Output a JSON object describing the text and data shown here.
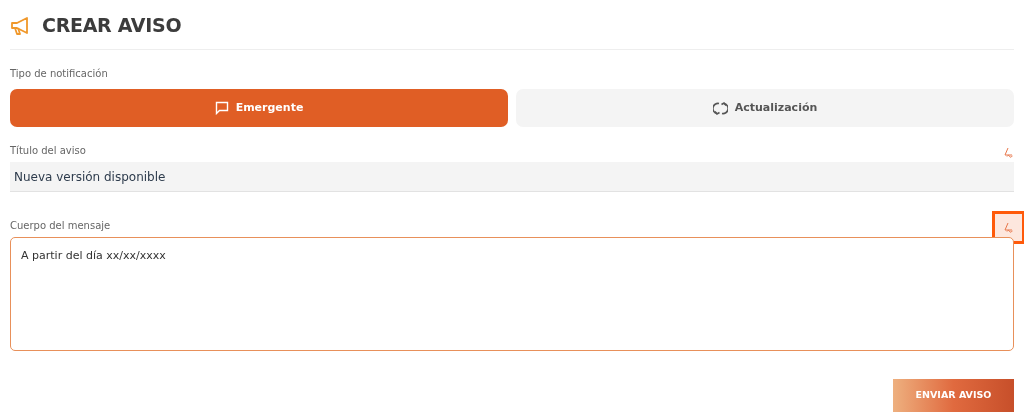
{
  "header": {
    "title": "CREAR AVISO"
  },
  "notification_type": {
    "label": "Tipo de notificación",
    "options": [
      {
        "label": "Emergente",
        "kind": "popup",
        "selected": true
      },
      {
        "label": "Actualización",
        "kind": "update",
        "selected": false
      }
    ]
  },
  "fields": [
    {
      "label": "Título del aviso",
      "kind": "input",
      "value": "Nueva versión disponible",
      "highlighted": false
    },
    {
      "label": "Cuerpo del mensaje",
      "kind": "textarea",
      "value": "A partir del día xx/xx/xxxx",
      "highlighted": true
    }
  ],
  "submit": {
    "label": "ENVIAR AVISO"
  }
}
